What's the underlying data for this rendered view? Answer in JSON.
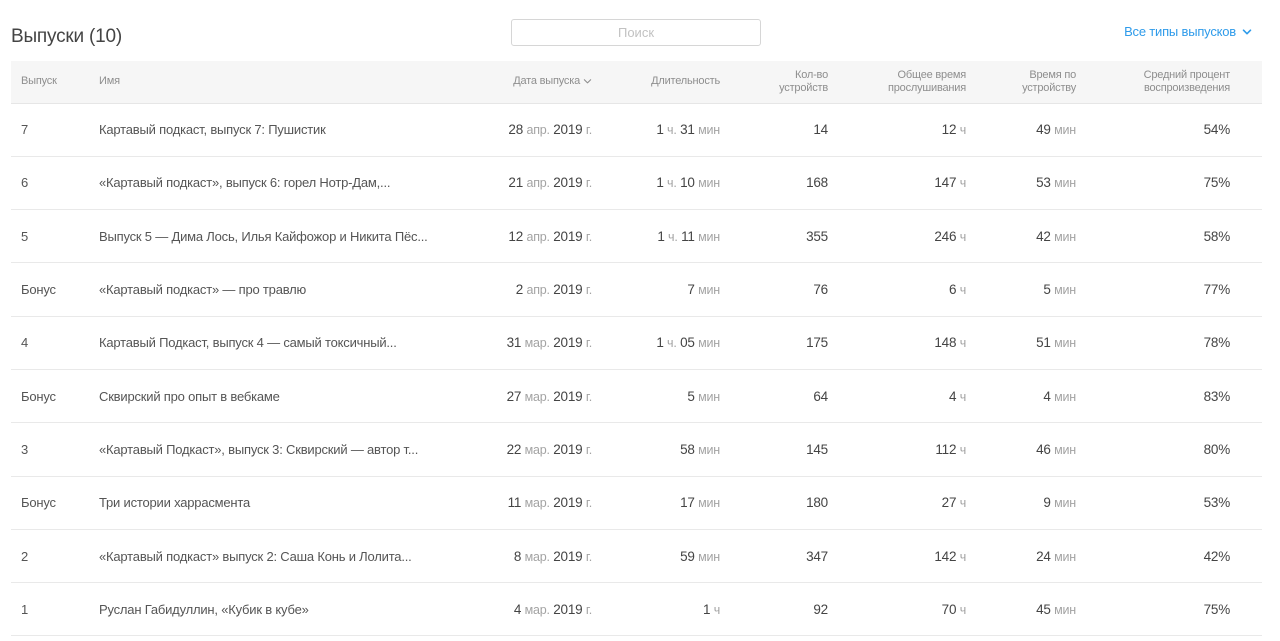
{
  "header": {
    "title": "Выпуски (10)",
    "search_placeholder": "Поиск",
    "filter_label": "Все типы выпусков"
  },
  "columns": {
    "episode": "Выпуск",
    "name": "Имя",
    "date": "Дата выпуска",
    "duration": "Длительность",
    "devices_l1": "Кол-во",
    "devices_l2": "устройств",
    "total_l1": "Общее время",
    "total_l2": "прослушивания",
    "per_l1": "Время по",
    "per_l2": "устройству",
    "avg_l1": "Средний процент",
    "avg_l2": "воспроизведения"
  },
  "rows": [
    {
      "ep": "7",
      "name": "Картавый подкаст, выпуск 7: Пушистик",
      "date_d": "28",
      "date_m": "апр.",
      "date_y": "2019",
      "date_g": "г.",
      "dur_h": "1",
      "dur_hu": "ч.",
      "dur_m": "31",
      "dur_mu": "мин",
      "devices": "14",
      "total": "12",
      "total_u": "ч",
      "per": "49",
      "per_u": "мин",
      "avg": "54%"
    },
    {
      "ep": "6",
      "name": "«Картавый подкаст», выпуск 6: горел Нотр-Дам,...",
      "date_d": "21",
      "date_m": "апр.",
      "date_y": "2019",
      "date_g": "г.",
      "dur_h": "1",
      "dur_hu": "ч.",
      "dur_m": "10",
      "dur_mu": "мин",
      "devices": "168",
      "total": "147",
      "total_u": "ч",
      "per": "53",
      "per_u": "мин",
      "avg": "75%"
    },
    {
      "ep": "5",
      "name": "Выпуск 5 — Дима Лось, Илья Кайфожор и Никита Пёс...",
      "date_d": "12",
      "date_m": "апр.",
      "date_y": "2019",
      "date_g": "г.",
      "dur_h": "1",
      "dur_hu": "ч.",
      "dur_m": "11",
      "dur_mu": "мин",
      "devices": "355",
      "total": "246",
      "total_u": "ч",
      "per": "42",
      "per_u": "мин",
      "avg": "58%"
    },
    {
      "ep": "Бонус",
      "name": "«Картавый подкаст» — про травлю",
      "date_d": "2",
      "date_m": "апр.",
      "date_y": "2019",
      "date_g": "г.",
      "dur_h": "",
      "dur_hu": "",
      "dur_m": "7",
      "dur_mu": "мин",
      "devices": "76",
      "total": "6",
      "total_u": "ч",
      "per": "5",
      "per_u": "мин",
      "avg": "77%"
    },
    {
      "ep": "4",
      "name": "Картавый Подкаст, выпуск 4 — самый токсичный...",
      "date_d": "31",
      "date_m": "мар.",
      "date_y": "2019",
      "date_g": "г.",
      "dur_h": "1",
      "dur_hu": "ч.",
      "dur_m": "05",
      "dur_mu": "мин",
      "devices": "175",
      "total": "148",
      "total_u": "ч",
      "per": "51",
      "per_u": "мин",
      "avg": "78%"
    },
    {
      "ep": "Бонус",
      "name": "Сквирский про опыт в вебкаме",
      "date_d": "27",
      "date_m": "мар.",
      "date_y": "2019",
      "date_g": "г.",
      "dur_h": "",
      "dur_hu": "",
      "dur_m": "5",
      "dur_mu": "мин",
      "devices": "64",
      "total": "4",
      "total_u": "ч",
      "per": "4",
      "per_u": "мин",
      "avg": "83%"
    },
    {
      "ep": "3",
      "name": "«Картавый Подкаст», выпуск 3: Сквирский — автор т...",
      "date_d": "22",
      "date_m": "мар.",
      "date_y": "2019",
      "date_g": "г.",
      "dur_h": "",
      "dur_hu": "",
      "dur_m": "58",
      "dur_mu": "мин",
      "devices": "145",
      "total": "112",
      "total_u": "ч",
      "per": "46",
      "per_u": "мин",
      "avg": "80%"
    },
    {
      "ep": "Бонус",
      "name": "Три истории харрасмента",
      "date_d": "11",
      "date_m": "мар.",
      "date_y": "2019",
      "date_g": "г.",
      "dur_h": "",
      "dur_hu": "",
      "dur_m": "17",
      "dur_mu": "мин",
      "devices": "180",
      "total": "27",
      "total_u": "ч",
      "per": "9",
      "per_u": "мин",
      "avg": "53%"
    },
    {
      "ep": "2",
      "name": "«Картавый подкаст» выпуск 2: Саша Конь и Лолита...",
      "date_d": "8",
      "date_m": "мар.",
      "date_y": "2019",
      "date_g": "г.",
      "dur_h": "",
      "dur_hu": "",
      "dur_m": "59",
      "dur_mu": "мин",
      "devices": "347",
      "total": "142",
      "total_u": "ч",
      "per": "24",
      "per_u": "мин",
      "avg": "42%"
    },
    {
      "ep": "1",
      "name": "Руслан Габидуллин, «Кубик в кубе»",
      "date_d": "4",
      "date_m": "мар.",
      "date_y": "2019",
      "date_g": "г.",
      "dur_h": "1",
      "dur_hu": "ч",
      "dur_m": "",
      "dur_mu": "",
      "devices": "92",
      "total": "70",
      "total_u": "ч",
      "per": "45",
      "per_u": "мин",
      "avg": "75%"
    }
  ],
  "colors": {
    "accent": "#2e9bea",
    "header_bg": "#f6f6f6"
  },
  "icons": {
    "filter": "chevron-down-icon",
    "sort": "chevron-down-icon"
  }
}
